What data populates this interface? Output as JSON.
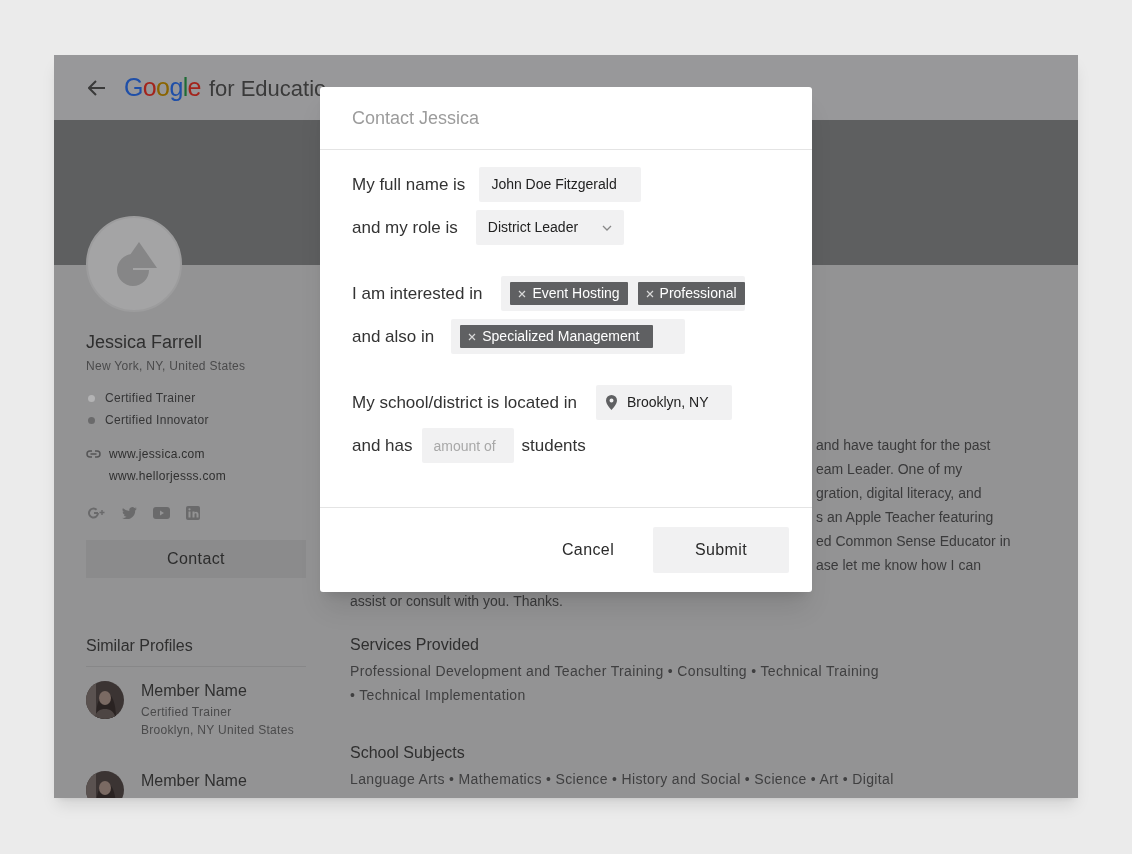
{
  "header": {
    "logo": "Google",
    "title": "for Educatio"
  },
  "profile": {
    "name": "Jessica Farrell",
    "location": "New York, NY, United States",
    "certifications": [
      {
        "label": "Certified Trainer",
        "color": "#b3b3b4"
      },
      {
        "label": "Certified Innovator",
        "color": "#6a6a6b"
      }
    ],
    "links": [
      "www.jessica.com",
      "www.hellorjesss.com"
    ],
    "contact_button": "Contact"
  },
  "similar_profiles": {
    "title": "Similar Profiles",
    "members": [
      {
        "name": "Member Name",
        "role": "Certified Trainer",
        "location": "Brooklyn, NY United States"
      },
      {
        "name": "Member Name"
      }
    ]
  },
  "about_lines": [
    "and have taught for the past",
    "eam Leader. One of my",
    "gration, digital literacy, and",
    "s an Apple Teacher featuring",
    "ed Common Sense Educator in",
    "ase let me know how I can",
    "assist or consult with you. Thanks."
  ],
  "sections": [
    {
      "title": "Services Provided",
      "lines": [
        "Professional Development and Teacher Training • Consulting • Technical Training",
        "• Technical Implementation"
      ]
    },
    {
      "title": "School Subjects",
      "lines": [
        "Language Arts • Mathematics • Science • History and Social • Science • Art • Digital"
      ]
    }
  ],
  "dialog": {
    "title": "Contact Jessica",
    "groups": [
      [
        {
          "kind": "text",
          "label": "My full name is",
          "value": "John Doe Fitzgerald"
        },
        {
          "kind": "select",
          "label": "and my role is",
          "value": "District Leader"
        }
      ],
      [
        {
          "kind": "chips",
          "label": "I am interested in",
          "chips": [
            "Event Hosting",
            "Professional"
          ]
        },
        {
          "kind": "chips",
          "label": "and also in",
          "chips": [
            "Specialized Management"
          ]
        }
      ],
      [
        {
          "kind": "location",
          "label": "My school/district is located in",
          "value": "Brooklyn, NY"
        },
        {
          "kind": "number",
          "label": "and has",
          "placeholder": "amount of",
          "suffix": "students"
        }
      ]
    ],
    "buttons": [
      {
        "kind": "text",
        "label": "Cancel"
      },
      {
        "kind": "filled",
        "label": "Submit"
      }
    ]
  }
}
